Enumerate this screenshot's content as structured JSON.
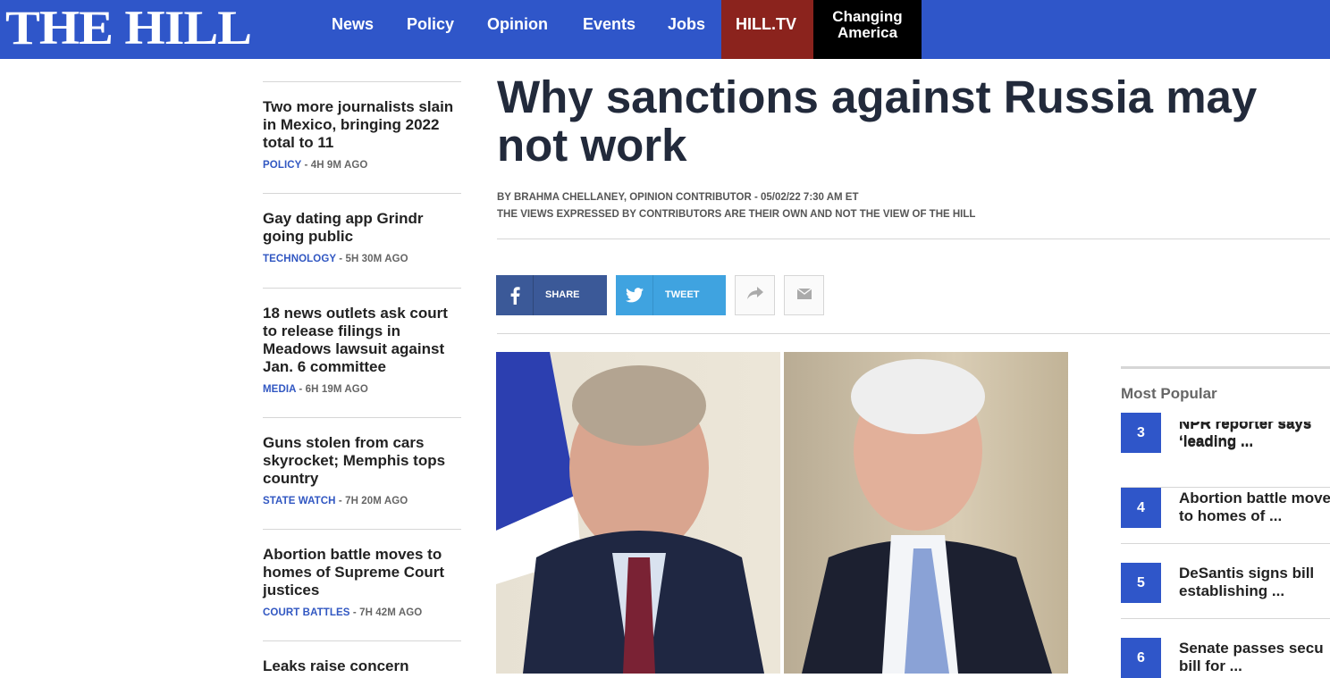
{
  "header": {
    "logo": "THE HILL",
    "nav": [
      "News",
      "Policy",
      "Opinion",
      "Events",
      "Jobs"
    ],
    "hilltv": "HILL.TV",
    "changing_line1": "Changing",
    "changing_line2": "America",
    "colors": {
      "bar": "#2f56c9",
      "hilltv": "#8b231d",
      "changing": "#000000"
    }
  },
  "sidebar": {
    "stories": [
      {
        "title": "Two more journalists slain in Mexico, bringing 2022 total to 11",
        "category": "POLICY",
        "time": " - 4H 9M AGO"
      },
      {
        "title": "Gay dating app Grindr going public",
        "category": "TECHNOLOGY",
        "time": " - 5H 30M AGO"
      },
      {
        "title": "18 news outlets ask court to release filings in Meadows lawsuit against Jan. 6 committee",
        "category": "MEDIA",
        "time": " - 6H 19M AGO"
      },
      {
        "title": "Guns stolen from cars skyrocket; Memphis tops country",
        "category": "STATE WATCH",
        "time": " - 7H 20M AGO"
      },
      {
        "title": "Abortion battle moves to homes of Supreme Court justices",
        "category": "COURT BATTLES",
        "time": " - 7H 42M AGO"
      },
      {
        "title": "Leaks raise concern",
        "category": "",
        "time": ""
      }
    ]
  },
  "article": {
    "headline": "Why sanctions against Russia may not work",
    "byline": "BY BRAHMA CHELLANEY, OPINION CONTRIBUTOR - 05/02/22 7:30 AM ET",
    "disclaimer": "THE VIEWS EXPRESSED BY CONTRIBUTORS ARE THEIR OWN AND NOT THE VIEW OF THE HILL"
  },
  "share": {
    "facebook_label": "SHARE",
    "twitter_label": "TWEET",
    "icons": [
      "facebook-icon",
      "twitter-icon",
      "share-arrow-icon",
      "email-icon"
    ]
  },
  "most_popular": {
    "title": "Most Popular",
    "items": [
      {
        "num": "3",
        "line1": "NPR reporter says",
        "line2": "‘leading ..."
      },
      {
        "num": "4",
        "line1": "Abortion battle moves",
        "line2": "to homes of ..."
      },
      {
        "num": "5",
        "line1": "DeSantis signs bill",
        "line2": "establishing ..."
      },
      {
        "num": "6",
        "line1": "Senate passes secu",
        "line2": "bill for ..."
      }
    ]
  }
}
